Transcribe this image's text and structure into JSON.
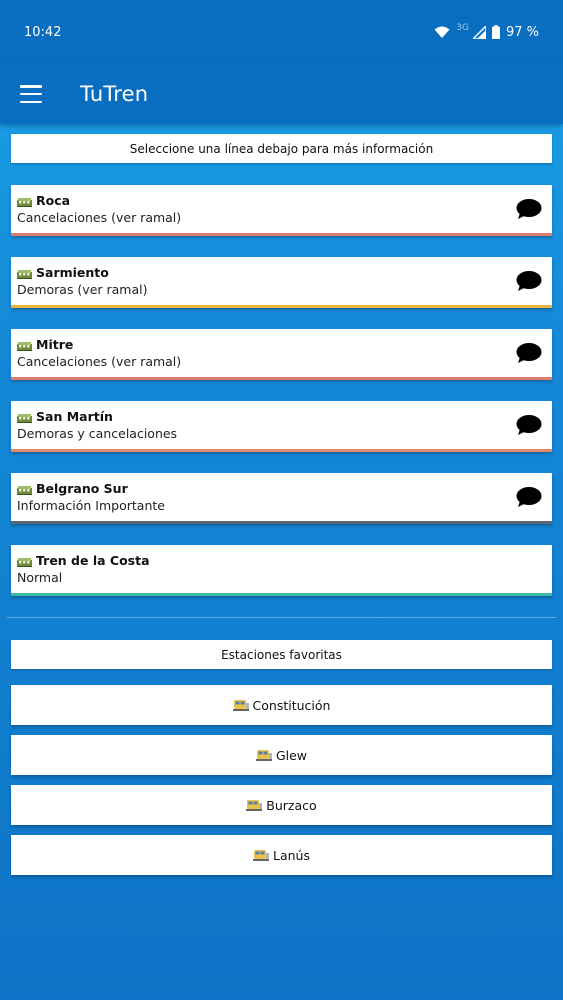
{
  "status_bar": {
    "time": "10:42",
    "network": "3G",
    "battery": "97 %"
  },
  "app": {
    "title": "TuTren"
  },
  "lines_header": "Seleccione una línea debajo para más información",
  "lines": [
    {
      "name": "Roca",
      "status": "Cancelaciones (ver ramal)",
      "color": "#e07a6a",
      "has_chat": true
    },
    {
      "name": "Sarmiento",
      "status": "Demoras (ver ramal)",
      "color": "#e8b63a",
      "has_chat": true
    },
    {
      "name": "Mitre",
      "status": "Cancelaciones (ver ramal)",
      "color": "#e07a6a",
      "has_chat": true
    },
    {
      "name": "San Martín",
      "status": "Demoras y cancelaciones",
      "color": "#e08a6a",
      "has_chat": true
    },
    {
      "name": "Belgrano Sur",
      "status": "Información Importante",
      "color": "#5b6470",
      "has_chat": true
    },
    {
      "name": "Tren de la Costa",
      "status": "Normal",
      "color": "#3fb8a6",
      "has_chat": false
    }
  ],
  "favorites_header": "Estaciones favoritas",
  "stations": [
    {
      "name": "Constitución"
    },
    {
      "name": "Glew"
    },
    {
      "name": "Burzaco"
    },
    {
      "name": "Lanús"
    }
  ],
  "icons": {
    "line": "train-line-icon",
    "station": "station-icon",
    "chat": "chat-bubble-icon",
    "menu": "hamburger-menu-icon"
  }
}
